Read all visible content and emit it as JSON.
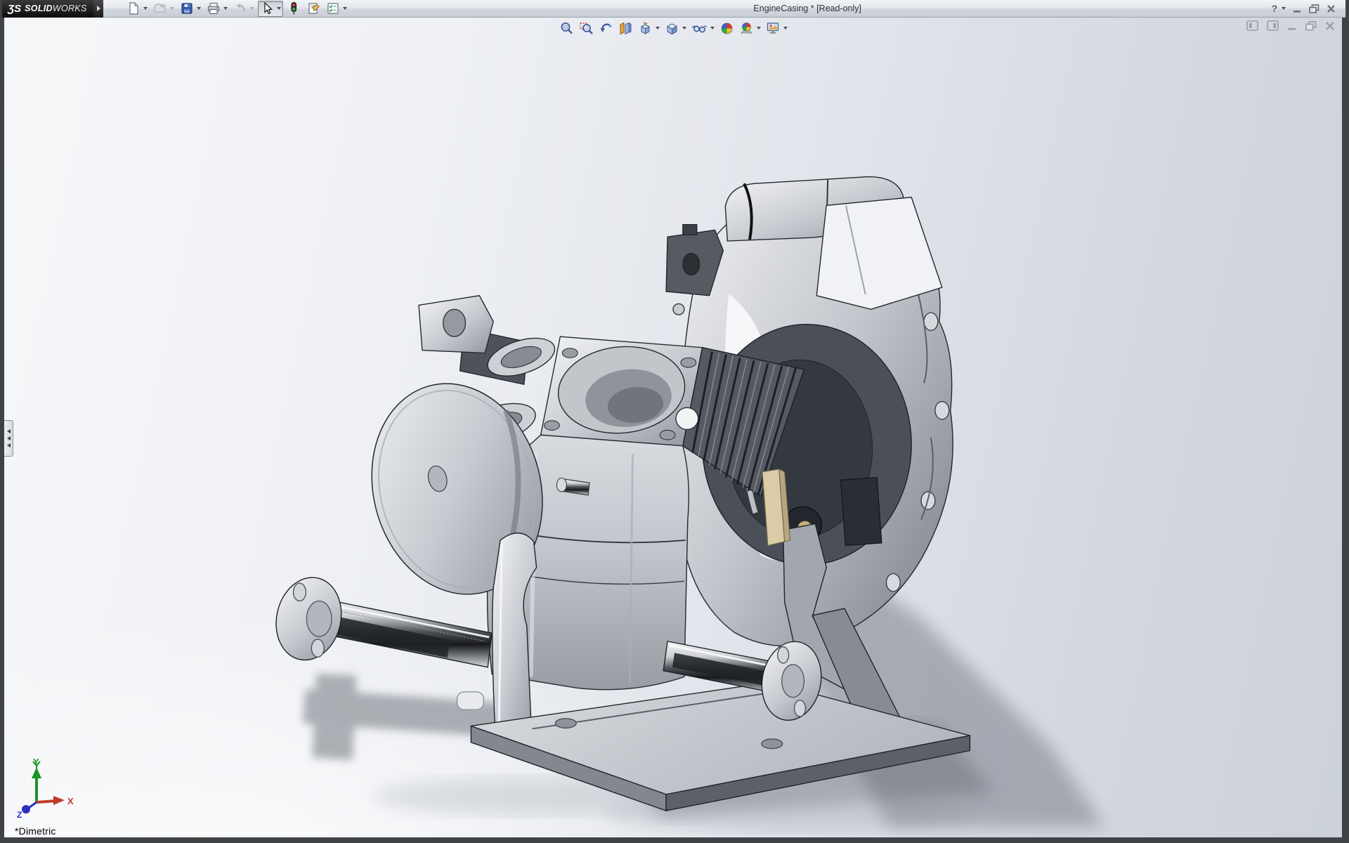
{
  "app": {
    "brand": {
      "glyph": "ƷS",
      "bold": "SOLID",
      "light": "WORKS"
    },
    "title": "EngineCasing * [Read-only]",
    "help_glyph": "?"
  },
  "quick_toolbar": [
    {
      "name": "new",
      "dropdown": true,
      "enabled": true
    },
    {
      "name": "open",
      "dropdown": true,
      "enabled": false
    },
    {
      "name": "save",
      "dropdown": true,
      "enabled": true
    },
    {
      "name": "print",
      "dropdown": true,
      "enabled": true
    },
    {
      "name": "undo",
      "dropdown": true,
      "enabled": false
    },
    {
      "name": "select",
      "dropdown": true,
      "enabled": true,
      "pressed": true
    },
    {
      "name": "rebuild",
      "dropdown": false,
      "enabled": true
    },
    {
      "name": "file-properties",
      "dropdown": false,
      "enabled": true
    },
    {
      "name": "options",
      "dropdown": true,
      "enabled": true
    }
  ],
  "headsup_toolbar": [
    {
      "name": "zoom-to-fit",
      "dropdown": false
    },
    {
      "name": "zoom-to-area",
      "dropdown": false
    },
    {
      "name": "previous-view",
      "dropdown": false
    },
    {
      "name": "section-view",
      "dropdown": false
    },
    {
      "name": "view-orientation",
      "dropdown": true
    },
    {
      "name": "display-style",
      "dropdown": true
    },
    {
      "name": "hide-show-items",
      "dropdown": true
    },
    {
      "name": "edit-appearance",
      "dropdown": false
    },
    {
      "name": "apply-scene",
      "dropdown": true
    },
    {
      "name": "view-settings",
      "dropdown": true
    }
  ],
  "window_controls": [
    {
      "name": "help"
    },
    {
      "name": "help-dropdown"
    },
    {
      "name": "minimize-window"
    },
    {
      "name": "restore-window"
    },
    {
      "name": "close-window"
    }
  ],
  "doc_controls": [
    {
      "name": "featuremanager-pane-left"
    },
    {
      "name": "featuremanager-pane-right"
    },
    {
      "name": "minimize-document"
    },
    {
      "name": "restore-document"
    },
    {
      "name": "close-document"
    }
  ],
  "viewport": {
    "view_label": "*Dimetric",
    "model_name": "engine-casing-on-test-stand",
    "triad": {
      "x_label": "X",
      "y_label": "Y",
      "z_label": "Z",
      "x_color": "#c23a2b",
      "y_color": "#1d9427",
      "z_color": "#2b2fc0"
    },
    "background": {
      "light": "#f6f7f9",
      "dark": "#ccd1da"
    }
  },
  "colors": {
    "titlebar_top": "#f2f4f7",
    "titlebar_bottom": "#c9ced6",
    "logo_bg": "#0c0c0c",
    "frame": "#3f4246",
    "model_metal_light": "#f2f3f5",
    "model_metal_dark": "#3f434a",
    "shadow": "#757a83",
    "accent_part_beige": "#dbcba6"
  }
}
